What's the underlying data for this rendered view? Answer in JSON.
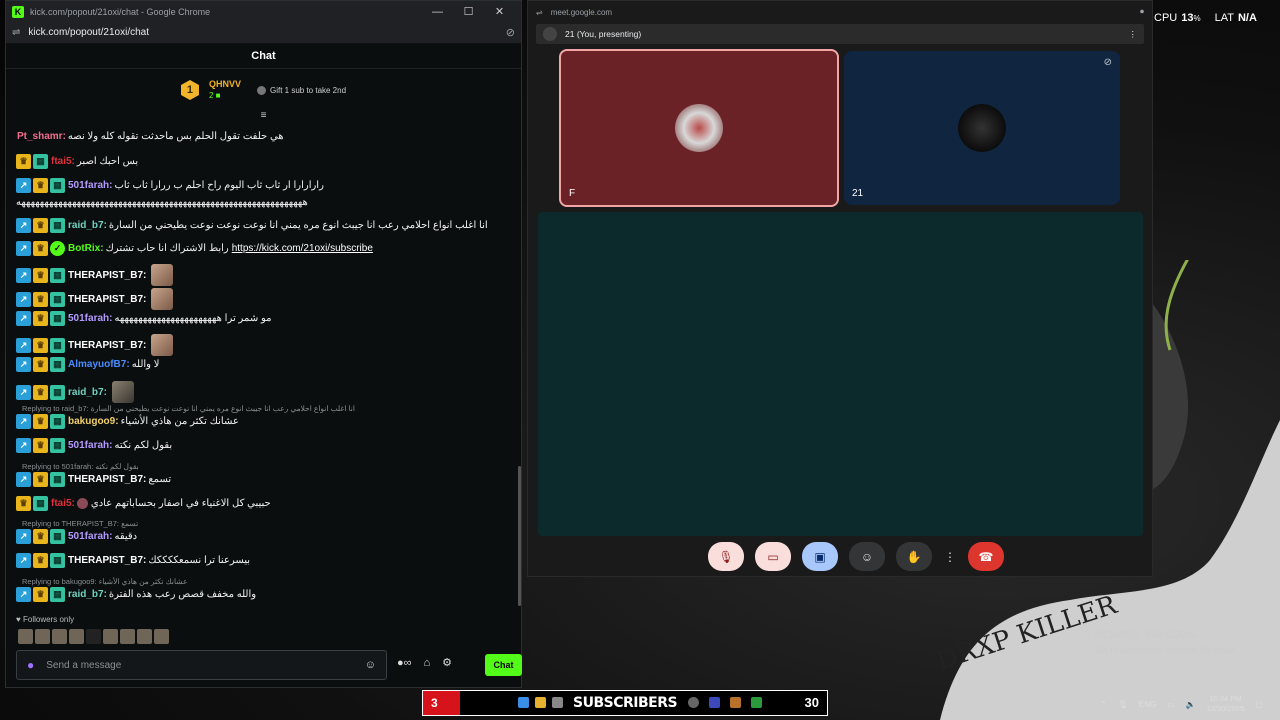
{
  "kick_window": {
    "title": "kick.com/popout/21oxi/chat - Google Chrome",
    "url": "kick.com/popout/21oxi/chat",
    "min_icon": "—",
    "max_icon": "☐",
    "close_icon": "✕"
  },
  "chat": {
    "header": "Chat",
    "leaderboard": {
      "rank": "1",
      "user": "QHNVV",
      "count": "2",
      "gift_text": "Gift 1 sub to take 2nd"
    },
    "messages": [
      {
        "user": "Pt_shamr:",
        "color": "#f06f8f",
        "text": "هي حلفت تقول الحلم بس ماحدثت تقوله كله ولا نصه"
      },
      {
        "user": "ftai5:",
        "color": "#e0313b",
        "text": "بس احبك اصبر"
      },
      {
        "user": "501farah:",
        "color": "#b49bff",
        "text": "رارارارا ار ثاب ثاب اليوم راح احلم ب ررارا ثاب ثاب"
      },
      {
        "user": "",
        "color": "#ffffff",
        "text": "ههههههههههههههههههههههههههههههههههههههههههههههههههههههههههههههه"
      },
      {
        "user": "raid_b7:",
        "color": "#6fd3c0",
        "text": "انا اغلب انواع احلامي رعب انا جيبث انوع مره يمني انا نوعت نوعت نوعت يطيحني من السارة"
      },
      {
        "user": "BotRix:",
        "color": "#53fc18",
        "text": "رابط الاشتراك انا حاب تشترك",
        "link": "https://kick.com/21oxi/subscribe"
      },
      {
        "user": "THERAPIST_B7:",
        "color": "#ffffff",
        "text": ""
      },
      {
        "user": "THERAPIST_B7:",
        "color": "#ffffff",
        "text": ""
      },
      {
        "user": "501farah:",
        "color": "#b49bff",
        "text": "مو شمر ترا ههههههههههههههههههههههه"
      },
      {
        "user": "THERAPIST_B7:",
        "color": "#ffffff",
        "text": ""
      },
      {
        "user": "AlmayuofB7:",
        "color": "#4a8cff",
        "text": "لا والله"
      },
      {
        "user": "raid_b7:",
        "color": "#6fd3c0",
        "text": ""
      },
      {
        "user": "bakugoo9:",
        "color": "#f2d06b",
        "text": "عشانك تكثر من هاذي الأشياء",
        "reply": "Replying to raid_b7: انا اغلب انواع احلامي رعب انا جيبث انوع مره يمني انا نوعت نوعت يطيحني من السارة"
      },
      {
        "user": "501farah:",
        "color": "#b49bff",
        "text": "بقول لكم نكته"
      },
      {
        "user": "THERAPIST_B7:",
        "color": "#ffffff",
        "text": "تسمع",
        "reply": "Replying to 501farah: بقول لكم نكته"
      },
      {
        "user": "ftai5:",
        "color": "#e0313b",
        "text": "حبيبي كل الاغنياء في اصفار بحساباتهم عادي"
      },
      {
        "user": "501farah:",
        "color": "#b49bff",
        "text": "دقيقه",
        "reply": "Replying to THERAPIST_B7: تسمع"
      },
      {
        "user": "THERAPIST_B7:",
        "color": "#ffffff",
        "text": "بيسرعنا ترا نسمعككككك"
      },
      {
        "user": "raid_b7:",
        "color": "#6fd3c0",
        "text": "والله مخفف قصص رعب هذه الفترة",
        "reply": "Replying to bakugoo9: عشانك تكثر من هاذي الأشياء"
      }
    ],
    "followers_only": "Followers only",
    "input_placeholder": "Send a message",
    "send_label": "Chat"
  },
  "meet_window": {
    "url": "meet.google.com",
    "presenting": "21 (You, presenting)",
    "tiles": [
      {
        "name": "F"
      },
      {
        "name": "21"
      }
    ]
  },
  "desktop": {
    "cpu_label": "CPU",
    "cpu_value": "13",
    "cpu_unit": "%",
    "lat_label": "LAT",
    "lat_value": "N/A",
    "watermark": "Activate Windows",
    "watermark_sub": "Go to Settings to activate Windows."
  },
  "overlay": {
    "count": "3",
    "label": "SUBSCRIBERS",
    "goal": "30"
  },
  "tray": {
    "lang": "ENG",
    "time": "10:34 PM",
    "date": "12/30/2025"
  }
}
